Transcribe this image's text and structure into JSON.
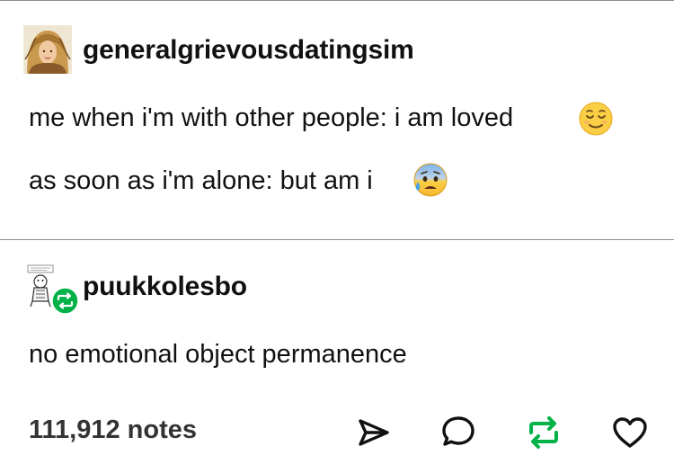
{
  "top_rule": true,
  "post_original": {
    "username": "generalgrievousdatingsim",
    "avatar_icon": "illustrated-portrait-avatar",
    "line1": "me when i'm with other people: i am loved",
    "line1_emoji": "relieved-face-emoji",
    "line2": "as soon as i'm alone: but am i",
    "line2_emoji": "anxious-face-with-sweat-emoji"
  },
  "post_reblog": {
    "username": "puukkolesbo",
    "avatar_icon": "comic-character-avatar",
    "badge_icon": "reblog-icon",
    "badge_color": "#00b248",
    "text": "no emotional object permanence"
  },
  "footer": {
    "notes": "111,912 notes",
    "actions": [
      {
        "name": "share",
        "icon": "share-icon"
      },
      {
        "name": "reply",
        "icon": "reply-icon"
      },
      {
        "name": "reblog",
        "icon": "reblog-icon",
        "color": "#00b248"
      },
      {
        "name": "like",
        "icon": "heart-icon"
      }
    ]
  }
}
